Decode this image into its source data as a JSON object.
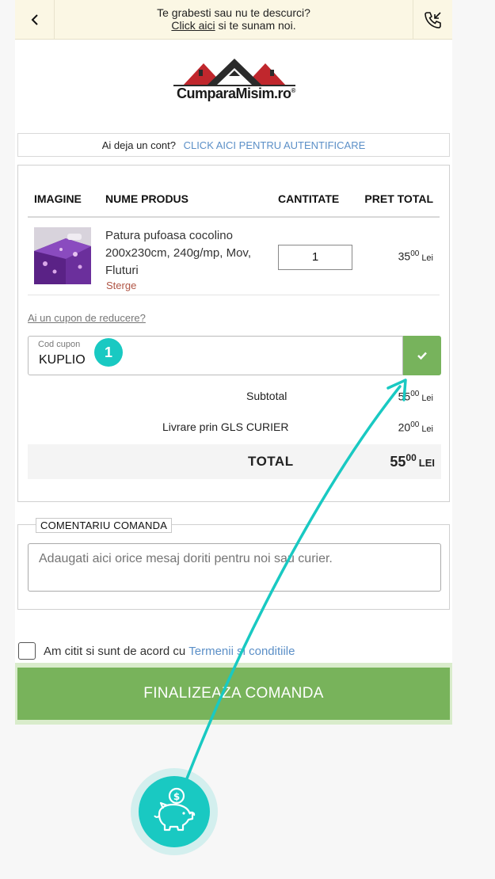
{
  "topbar": {
    "line1": "Te grabesti sau nu te descurci?",
    "link": "Click aici",
    "line2_rest": " si te sunam noi."
  },
  "logo": {
    "text": "CumparaMisim.ro",
    "reg": "®"
  },
  "account": {
    "question": "Ai deja un cont?",
    "link": "CLICK AICI PENTRU AUTENTIFICARE"
  },
  "table": {
    "headers": {
      "image": "IMAGINE",
      "name": "NUME PRODUS",
      "qty": "CANTITATE",
      "price": "PRET TOTAL"
    },
    "items": [
      {
        "name": "Patura pufoasa cocolino 200x230cm, 240g/mp, Mov, Fluturi",
        "remove": "Sterge",
        "qty": "1",
        "price_int": "35",
        "price_dec": "00",
        "currency": "Lei"
      }
    ]
  },
  "coupon": {
    "link": "Ai un cupon de reducere?",
    "label": "Cod cupon",
    "value": "KUPLIO"
  },
  "summary": {
    "subtotal_label": "Subtotal",
    "subtotal_int": "55",
    "subtotal_dec": "00",
    "delivery_label": "Livrare prin GLS CURIER",
    "delivery_int": "20",
    "delivery_dec": "00",
    "currency": "Lei",
    "total_label": "TOTAL",
    "total_int": "55",
    "total_dec": "00",
    "total_currency": "LEI"
  },
  "comment": {
    "legend": "COMENTARIU COMANDA",
    "placeholder": "Adaugati aici orice mesaj doriti pentru noi sau curier."
  },
  "terms": {
    "text": "Am citit si sunt de acord cu",
    "link": "Termenii si conditiile"
  },
  "finalize": {
    "label": "FINALIZEAZA COMANDA"
  },
  "overlay": {
    "badge": "1",
    "accent": "#19c9c2"
  },
  "colors": {
    "green": "#78b35b",
    "link_blue": "#5b8fc7",
    "topbar_bg": "#fbf7e4",
    "remove_red": "#b05545"
  }
}
